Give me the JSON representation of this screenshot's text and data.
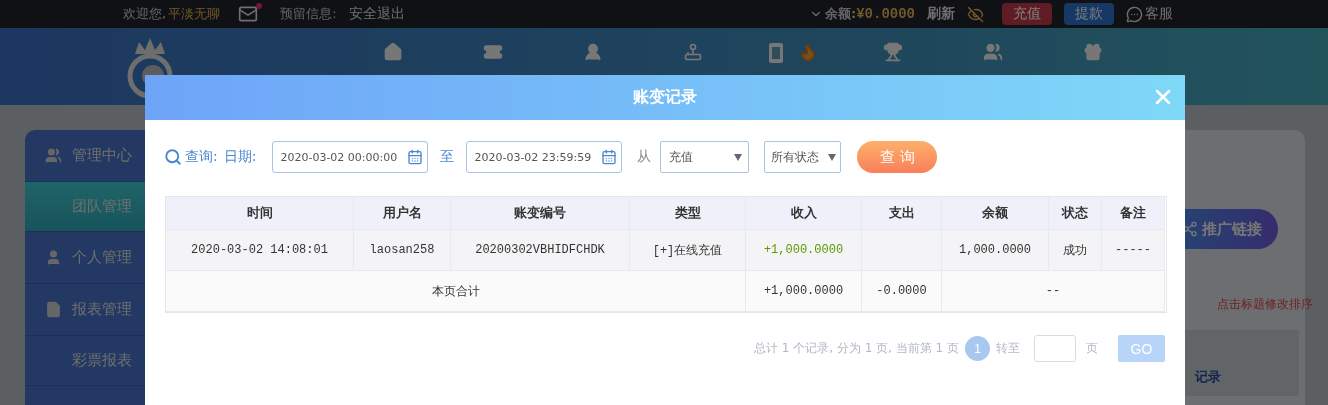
{
  "top_bar": {
    "welcome": "欢迎您,",
    "username": "平淡无聊",
    "has_unread_mail": true,
    "reserved_info": "预留信息:",
    "logout": "安全退出",
    "balance_label": "余额:",
    "balance": "¥0.0000",
    "refresh": "刷新",
    "deposit": "充值",
    "withdraw": "提款",
    "support": "客服"
  },
  "sidebar": {
    "items": [
      {
        "label": "管理中心",
        "kind": "section",
        "selected": false
      },
      {
        "label": "团队管理",
        "kind": "sub",
        "selected": true
      },
      {
        "label": "个人管理",
        "kind": "section",
        "selected": false
      },
      {
        "label": "报表管理",
        "kind": "section",
        "selected": false
      },
      {
        "label": "彩票报表",
        "kind": "sub",
        "selected": false
      }
    ]
  },
  "right_panel": {
    "promo_button": "推广链接",
    "hint": "点击标题修改排序",
    "link": "记录"
  },
  "dialog": {
    "title": "账变记录",
    "filter": {
      "query_label": "查询:",
      "date_label": "日期:",
      "start": "2020-03-02 00:00:00",
      "to": "至",
      "end": "2020-03-02 23:59:59",
      "from": "从",
      "type": "充值",
      "status": "所有状态",
      "search_button": "查 询"
    },
    "table": {
      "columns": [
        "时间",
        "用户名",
        "账变编号",
        "类型",
        "收入",
        "支出",
        "余额",
        "状态",
        "备注"
      ],
      "rows": [
        {
          "cells": [
            "2020-03-02 14:08:01",
            "laosan258",
            "20200302VBHIDFCHDK",
            "[+]在线充值",
            "+1,000.0000",
            "",
            "1,000.0000",
            "成功",
            "-----"
          ]
        }
      ],
      "total": {
        "label": "本页合计",
        "income": "+1,000.0000",
        "expense": "-0.0000",
        "rest": "--"
      }
    },
    "pager": {
      "summary": "总计 1 个记录, 分为 1 页, 当前第 1 页",
      "pages": [
        {
          "label": "1",
          "selected": true
        }
      ],
      "goto": "转至",
      "page_unit": "页",
      "go": "GO"
    }
  }
}
